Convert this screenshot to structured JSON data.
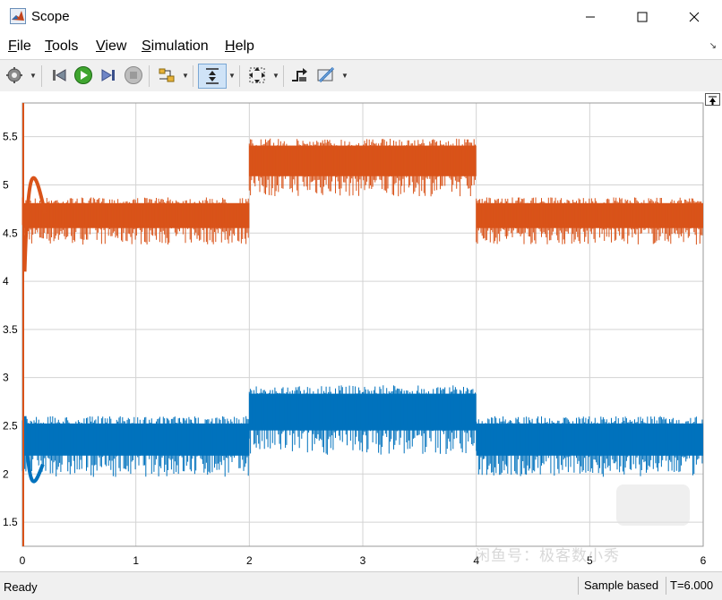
{
  "window": {
    "title": "Scope",
    "app_icon": "matlab-logo-icon"
  },
  "window_controls": [
    "minimize-icon",
    "maximize-icon",
    "close-icon"
  ],
  "menu": [
    {
      "label": "File",
      "mnemonic": "F",
      "rest": "ile"
    },
    {
      "label": "Tools",
      "mnemonic": "T",
      "rest": "ools"
    },
    {
      "label": "View",
      "mnemonic": "V",
      "rest": "iew"
    },
    {
      "label": "Simulation",
      "mnemonic": "S",
      "rest": "imulation"
    },
    {
      "label": "Help",
      "mnemonic": "H",
      "rest": "elp"
    }
  ],
  "toolbar": [
    "settings-icon",
    "step-back-icon",
    "run-icon",
    "step-forward-icon",
    "stop-icon",
    "highlight-block-icon",
    "zoom-icon",
    "fit-view-icon",
    "triggers-icon",
    "measurement-icon"
  ],
  "colors": {
    "series1": "#D95319",
    "series2": "#0072BD",
    "grid": "#d3d3d3",
    "cursor_line": "#D95319"
  },
  "chart_data": {
    "type": "line",
    "title": "",
    "xlabel": "",
    "ylabel": "",
    "xlim": [
      0,
      6
    ],
    "ylim": [
      1.25,
      5.85
    ],
    "xticks": [
      "0",
      "1",
      "2",
      "3",
      "4",
      "5",
      "6"
    ],
    "yticks": [
      "1.5",
      "2",
      "2.5",
      "3",
      "3.5",
      "4",
      "4.5",
      "5",
      "5.5"
    ],
    "grid": true,
    "series": [
      {
        "color": "#D95319",
        "segments": [
          {
            "x": [
              0,
              2
            ],
            "upper": 4.87,
            "lower": 4.38
          },
          {
            "x": [
              2,
              4
            ],
            "upper": 5.48,
            "lower": 4.88
          },
          {
            "x": [
              4,
              6
            ],
            "upper": 4.87,
            "lower": 4.38
          }
        ]
      },
      {
        "color": "#0072BD",
        "segments": [
          {
            "x": [
              0,
              2
            ],
            "upper": 2.6,
            "lower": 1.97
          },
          {
            "x": [
              2,
              4
            ],
            "upper": 2.92,
            "lower": 2.2
          },
          {
            "x": [
              4,
              6
            ],
            "upper": 2.6,
            "lower": 1.97
          }
        ]
      }
    ]
  },
  "status": {
    "ready": "Ready",
    "sample": "Sample based",
    "time": "T=6.000"
  },
  "watermark": "闲鱼号：极客数小秀"
}
